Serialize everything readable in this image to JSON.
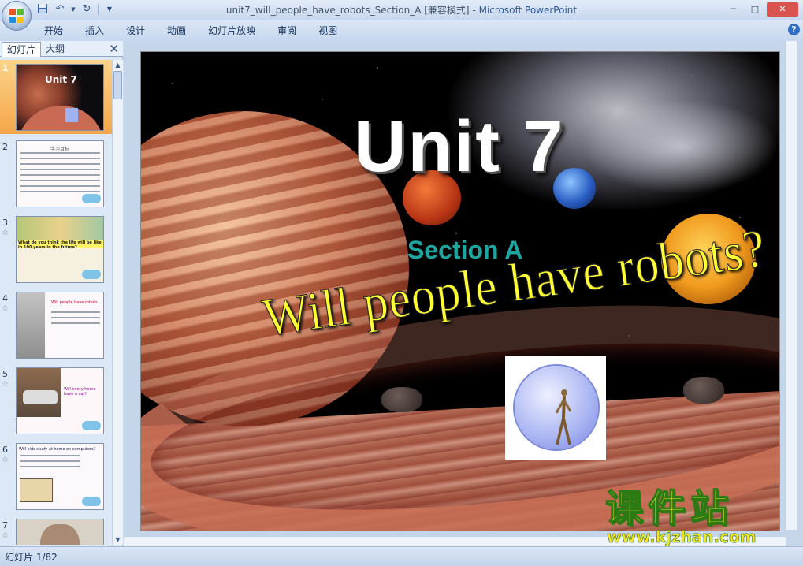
{
  "window": {
    "title": "unit7_will_people_have_robots_Section_A [兼容模式]",
    "separator": " - ",
    "app_name": "Microsoft PowerPoint"
  },
  "quick_access": [
    "save-icon",
    "undo-icon",
    "redo-icon",
    "customize-icon"
  ],
  "menu": [
    "开始",
    "插入",
    "设计",
    "动画",
    "幻灯片放映",
    "审阅",
    "视图"
  ],
  "pane": {
    "tab_slides": "幻灯片",
    "tab_outline": "大纲",
    "close": "✕"
  },
  "thumbnails": [
    {
      "num": "1",
      "star": "",
      "label": "Unit 7"
    },
    {
      "num": "2",
      "star": "",
      "label": "学习目标"
    },
    {
      "num": "3",
      "star": "☆",
      "label": "What do you think the life will be like in 100 years in the future?"
    },
    {
      "num": "4",
      "star": "☆",
      "label": "Will people have robots"
    },
    {
      "num": "5",
      "star": "☆",
      "label": "Will every home have a car?"
    },
    {
      "num": "6",
      "star": "☆",
      "label": "Will kids study at home on computers?"
    },
    {
      "num": "7",
      "star": "☆",
      "label": ""
    }
  ],
  "slide": {
    "title": "Unit 7",
    "subtitle": "Section A",
    "question": "Will people have robots?"
  },
  "watermark": {
    "cn": "课件站",
    "url": "www.kjzhan.com"
  },
  "status": {
    "slide_counter": "幻灯片 1/82"
  },
  "colors": {
    "title_white": "#ffffff",
    "subtitle_teal": "#1ea5a0",
    "question_yellow": "#ffff33",
    "selected_thumb": "#f6a64a"
  }
}
